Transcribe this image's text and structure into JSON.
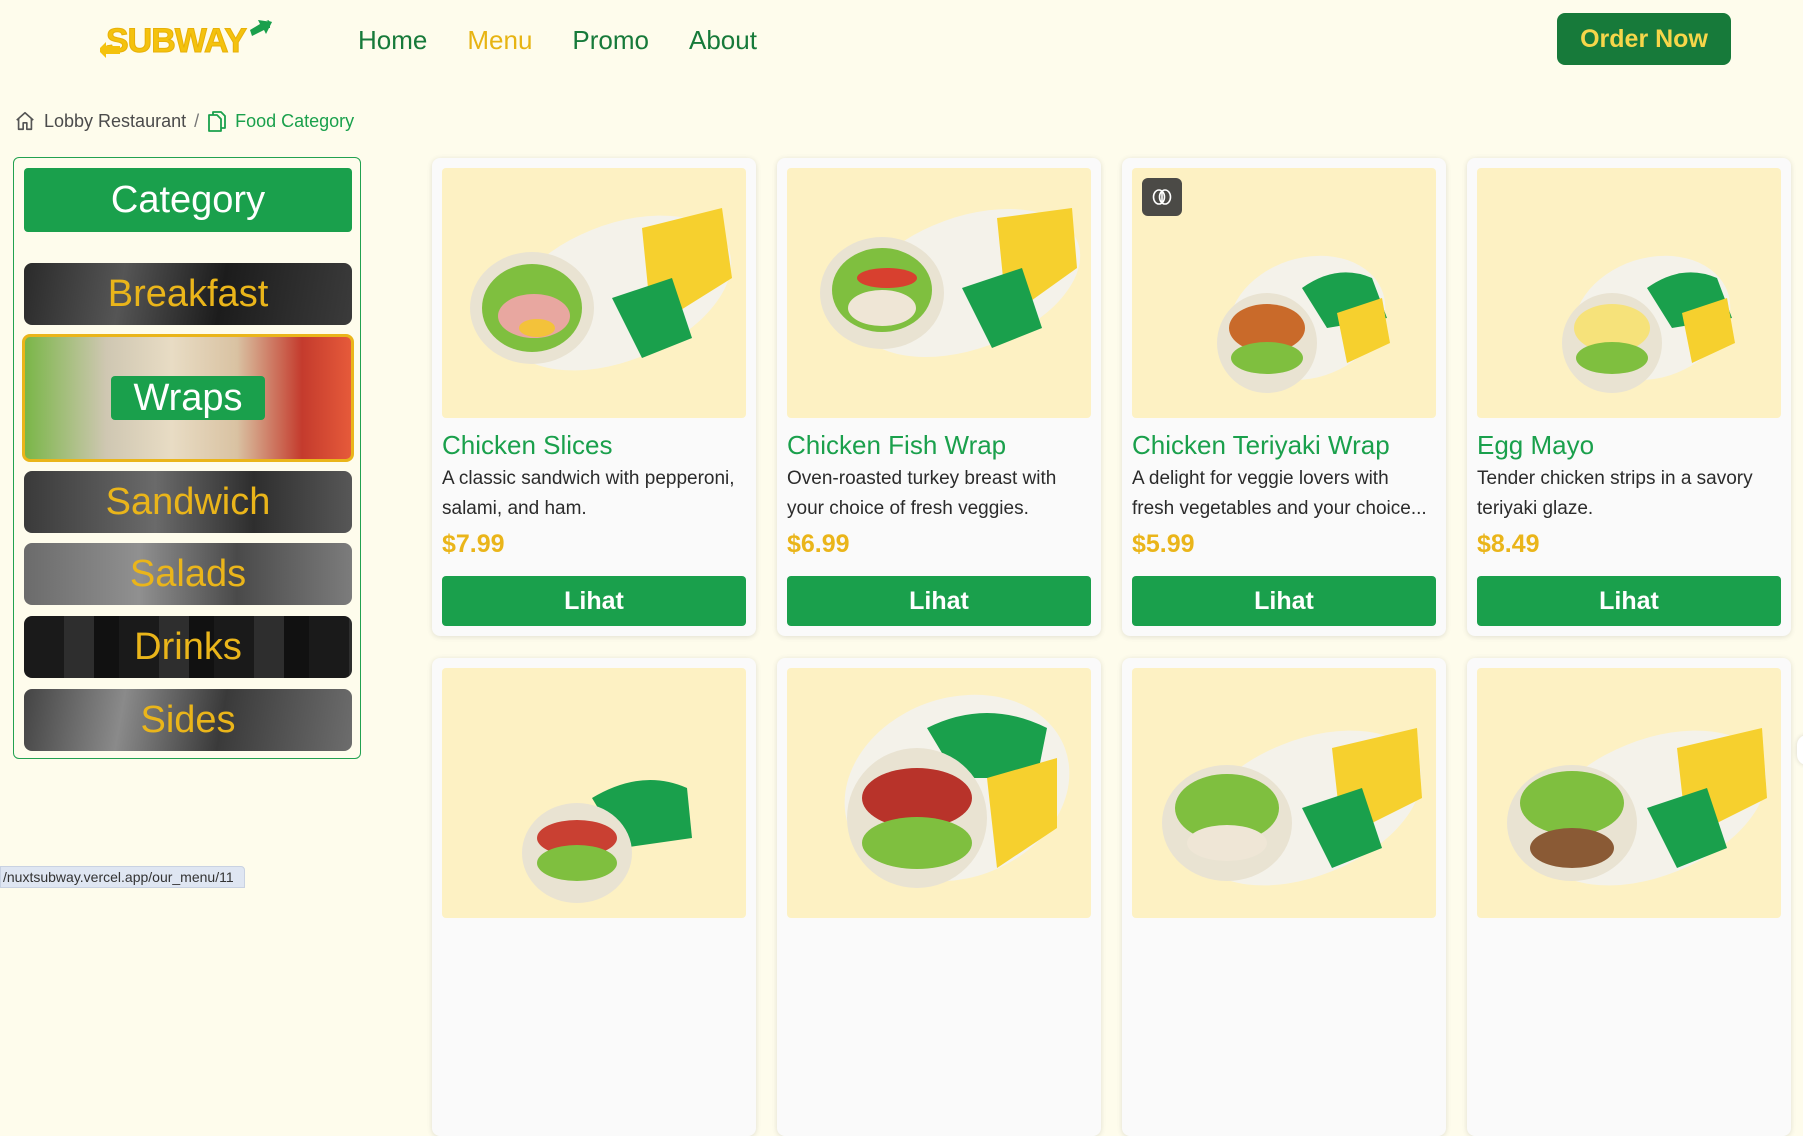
{
  "brand": {
    "logo_text": "SUBWAY"
  },
  "nav": {
    "links": [
      {
        "label": "Home",
        "active": false
      },
      {
        "label": "Menu",
        "active": true
      },
      {
        "label": "Promo",
        "active": false
      },
      {
        "label": "About",
        "active": false
      }
    ],
    "order_button": "Order Now"
  },
  "breadcrumb": {
    "home": "Lobby Restaurant",
    "separator": "/",
    "current": "Food Category"
  },
  "sidebar": {
    "title": "Category",
    "items": [
      {
        "label": "Breakfast",
        "selected": false
      },
      {
        "label": "Wraps",
        "selected": true
      },
      {
        "label": "Sandwich",
        "selected": false
      },
      {
        "label": "Salads",
        "selected": false
      },
      {
        "label": "Drinks",
        "selected": false
      },
      {
        "label": "Sides",
        "selected": false
      }
    ]
  },
  "products": [
    {
      "name": "Chicken Slices",
      "description": "A classic sandwich with pepperoni, salami, and ham.",
      "price": "$7.99",
      "button": "Lihat"
    },
    {
      "name": "Chicken Fish Wrap",
      "description": "Oven-roasted turkey breast with your choice of fresh veggies.",
      "price": "$6.99",
      "button": "Lihat"
    },
    {
      "name": "Chicken Teriyaki Wrap",
      "description": "A delight for veggie lovers with fresh vegetables and your choice...",
      "price": "$5.99",
      "button": "Lihat"
    },
    {
      "name": "Egg Mayo",
      "description": "Tender chicken strips in a savory teriyaki glaze.",
      "price": "$8.49",
      "button": "Lihat"
    }
  ],
  "status_bar": {
    "url": "/nuxtsubway.vercel.app/our_menu/11"
  },
  "colors": {
    "background": "#fefcec",
    "brand_green": "#1aa04c",
    "dark_green": "#177a3a",
    "brand_yellow": "#eab51a",
    "image_bg": "#fdf1c3"
  }
}
